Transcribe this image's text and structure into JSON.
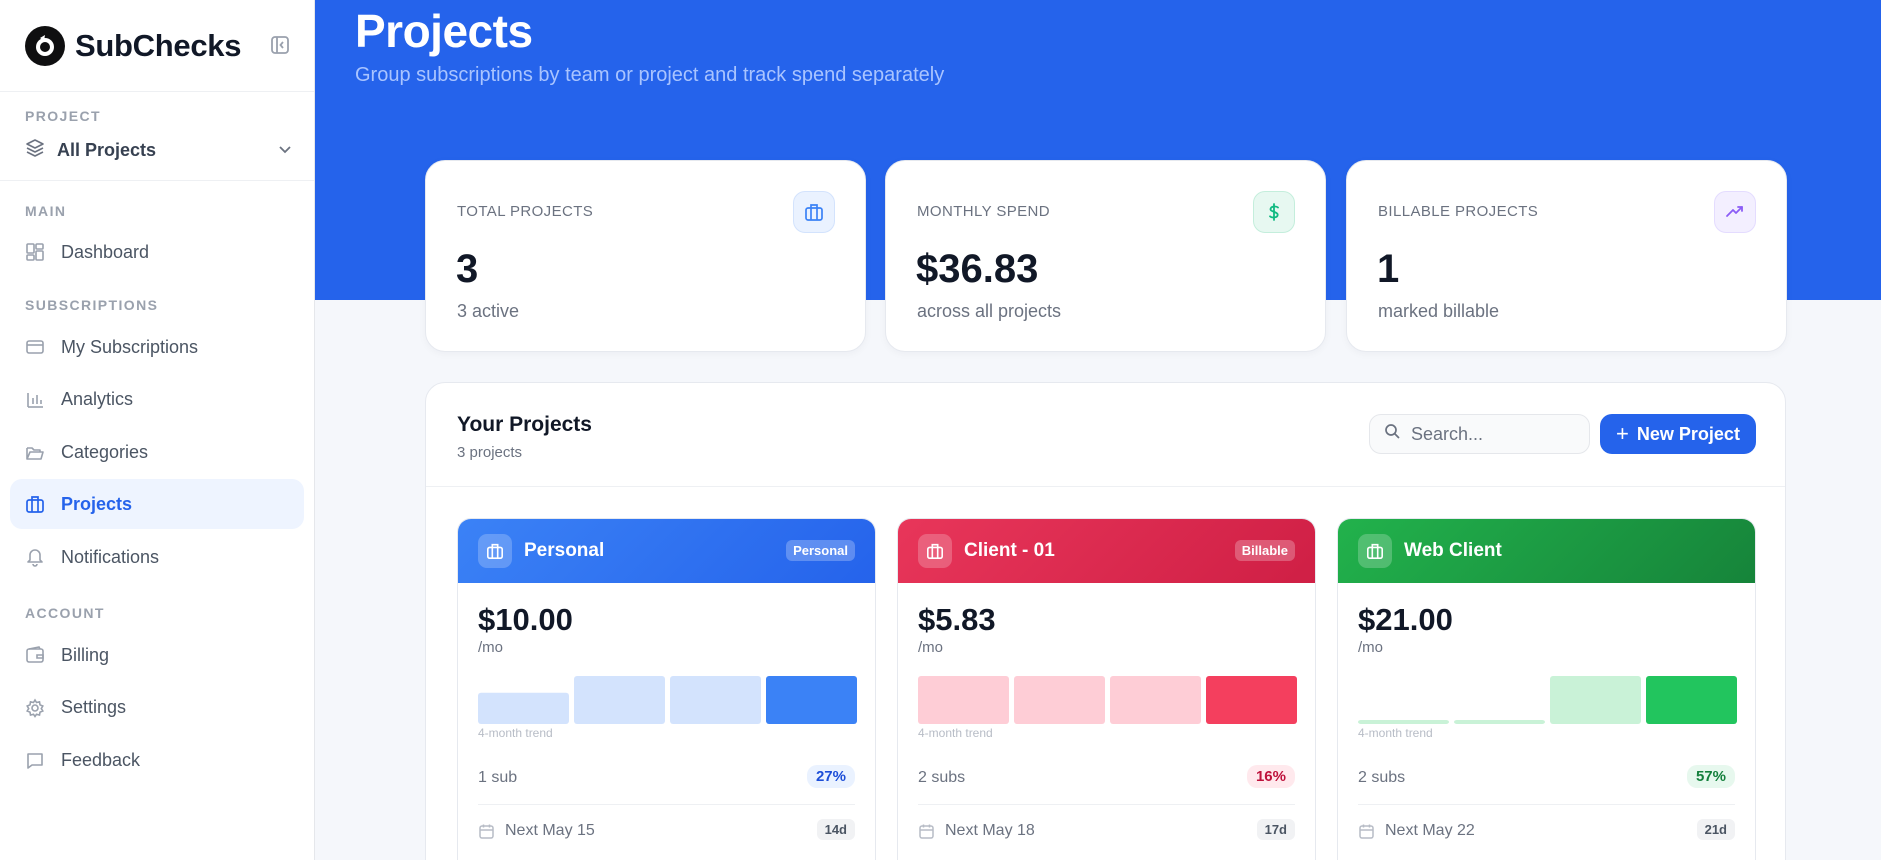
{
  "brand": {
    "name": "SubChecks"
  },
  "sidebar": {
    "project_section": "PROJECT",
    "project_selected": "All Projects",
    "sections": [
      {
        "label": "MAIN",
        "items": [
          {
            "label": "Dashboard",
            "icon": "grid-icon"
          }
        ]
      },
      {
        "label": "SUBSCRIPTIONS",
        "items": [
          {
            "label": "My Subscriptions",
            "icon": "card-icon"
          },
          {
            "label": "Analytics",
            "icon": "bar-chart-icon"
          },
          {
            "label": "Categories",
            "icon": "folder-icon"
          },
          {
            "label": "Projects",
            "icon": "briefcase-icon",
            "active": true
          },
          {
            "label": "Notifications",
            "icon": "bell-icon"
          }
        ]
      },
      {
        "label": "ACCOUNT",
        "items": [
          {
            "label": "Billing",
            "icon": "wallet-icon"
          },
          {
            "label": "Settings",
            "icon": "gear-icon"
          },
          {
            "label": "Feedback",
            "icon": "message-icon"
          }
        ]
      }
    ]
  },
  "header": {
    "title": "Projects",
    "subtitle": "Group subscriptions by team or project and track spend separately"
  },
  "stats": [
    {
      "label": "TOTAL PROJECTS",
      "value": "3",
      "sub": "3 active",
      "icon": "briefcase-icon",
      "color": "#3b82f6",
      "bg": "#eaf2ff"
    },
    {
      "label": "MONTHLY SPEND",
      "value": "$36.83",
      "sub": "across all projects",
      "icon": "dollar-icon",
      "color": "#10b981",
      "bg": "#e7f8f1"
    },
    {
      "label": "BILLABLE PROJECTS",
      "value": "1",
      "sub": "marked billable",
      "icon": "trending-up-icon",
      "color": "#8b5cf6",
      "bg": "#f3efff"
    }
  ],
  "panel": {
    "title": "Your Projects",
    "count": "3 projects",
    "search_placeholder": "Search...",
    "new_button": "New Project"
  },
  "projects": [
    {
      "name": "Personal",
      "badge": "Personal",
      "amount": "$10.00",
      "per": "/mo",
      "trend_label": "4-month trend",
      "trend": [
        0.65,
        1.0,
        1.0,
        1.0
      ],
      "subs": "1 sub",
      "pct": "27%",
      "next": "Next May 15",
      "days": "14d",
      "colors": {
        "from": "#3b82f6",
        "to": "#2563eb",
        "bar_light": "#d3e3fd",
        "bar_dark": "#3b82f6",
        "pct_bg": "#eaf2ff",
        "pct_fg": "#1d4ed8"
      }
    },
    {
      "name": "Client - 01",
      "badge": "Billable",
      "amount": "$5.83",
      "per": "/mo",
      "trend_label": "4-month trend",
      "trend": [
        1.0,
        1.0,
        1.0,
        1.0
      ],
      "subs": "2 subs",
      "pct": "16%",
      "next": "Next May 18",
      "days": "17d",
      "colors": {
        "from": "#e8365a",
        "to": "#cf1f45",
        "bar_light": "#fecdd6",
        "bar_dark": "#f43f5e",
        "pct_bg": "#ffe9ed",
        "pct_fg": "#be123c"
      }
    },
    {
      "name": "Web Client",
      "badge": "",
      "amount": "$21.00",
      "per": "/mo",
      "trend_label": "4-month trend",
      "trend": [
        0.08,
        0.08,
        1.0,
        1.0
      ],
      "subs": "2 subs",
      "pct": "57%",
      "next": "Next May 22",
      "days": "21d",
      "colors": {
        "from": "#22b24c",
        "to": "#16843a",
        "bar_light": "#c9f2d7",
        "bar_dark": "#22c55e",
        "pct_bg": "#e7f8ee",
        "pct_fg": "#15803d"
      }
    }
  ]
}
